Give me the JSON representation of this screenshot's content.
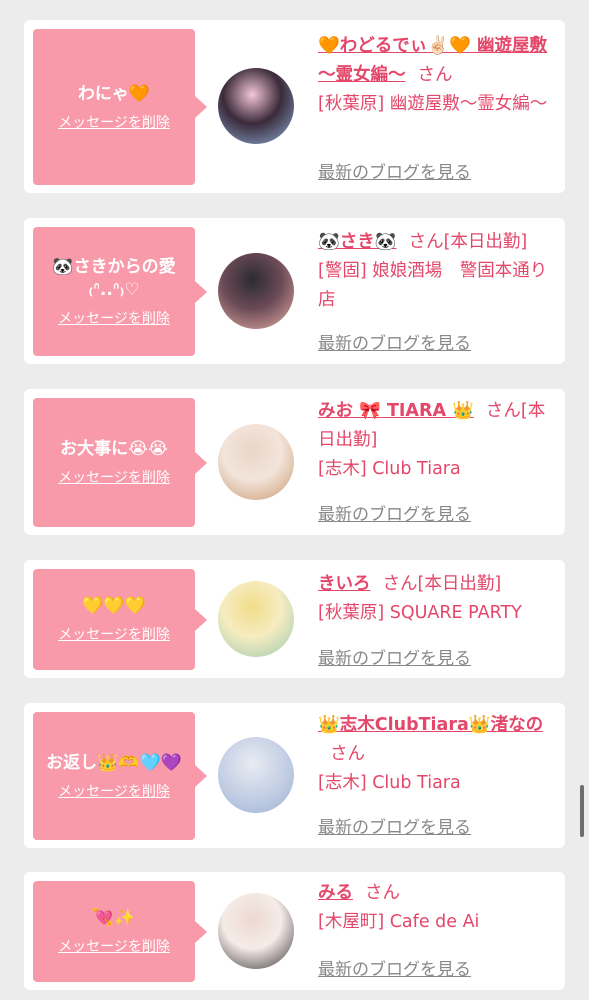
{
  "cards": [
    {
      "message": "わにゃ🧡",
      "delete_label": "メッセージを削除",
      "name": "🧡わどるでぃ✌🏻🧡 幽遊屋敷 〜霊女編〜",
      "san": "さん",
      "today": "",
      "shop": "[秋葉原] 幽遊屋敷〜霊女編〜",
      "blog_label": "最新のブログを見る",
      "avatar_colors": [
        "#f4c6d6",
        "#8fb0d8",
        "#3a2a3a"
      ]
    },
    {
      "message": "🐼さきからの愛 ₍ᐢ..ᐢ₎♡",
      "delete_label": "メッセージを削除",
      "name": "🐼さき🐼",
      "san": "さん",
      "today": "[本日出勤]",
      "shop": "[警固] 娘娘酒場　警固本通り店",
      "blog_label": "最新のブログを見る",
      "avatar_colors": [
        "#2b2b33",
        "#e8b0a8",
        "#6a4a55"
      ]
    },
    {
      "message": "お大事に😭😭",
      "delete_label": "メッセージを削除",
      "name": "みお 🎀 TIARA 👑",
      "san": "さん",
      "today": "[本日出勤]",
      "shop": "[志木] Club Tiara",
      "blog_label": "最新のブログを見る",
      "avatar_colors": [
        "#e9d6c8",
        "#c89a70",
        "#f3e4da"
      ]
    },
    {
      "message": "💛💛💛",
      "delete_label": "メッセージを削除",
      "name": "きいろ",
      "san": "さん",
      "today": "[本日出勤]",
      "shop": "[秋葉原] SQUARE PARTY",
      "blog_label": "最新のブログを見る",
      "avatar_colors": [
        "#f2dd8a",
        "#9ccab0",
        "#f6ecc0"
      ]
    },
    {
      "message": "お返し👑🫶🩵💜",
      "delete_label": "メッセージを削除",
      "name": "👑志木ClubTiara👑渚なの",
      "san": "さん",
      "today": "",
      "shop": "[志木] Club Tiara",
      "blog_label": "最新のブログを見る",
      "avatar_colors": [
        "#e8ebf2",
        "#9db3d6",
        "#c9d3e6"
      ]
    },
    {
      "message": "💘✨",
      "delete_label": "メッセージを削除",
      "name": "みる",
      "san": "さん",
      "today": "",
      "shop": "[木屋町] Cafe de Ai",
      "blog_label": "最新のブログを見る",
      "avatar_colors": [
        "#ecd8d0",
        "#3a3036",
        "#f4ece8"
      ]
    }
  ]
}
